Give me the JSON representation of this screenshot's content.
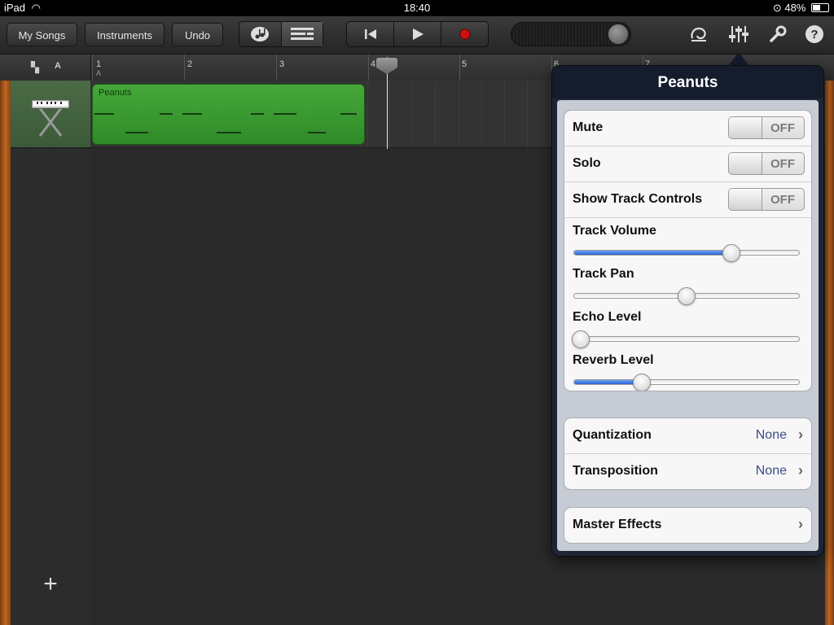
{
  "status_bar": {
    "device": "iPad",
    "time": "18:40",
    "battery": "48%"
  },
  "toolbar": {
    "my_songs": "My Songs",
    "instruments": "Instruments",
    "undo": "Undo",
    "view_toggle": {
      "left_icon": "smart-instrument-icon",
      "right_icon": "tracks-view-icon",
      "active": "tracks"
    },
    "transport": {
      "rewind_icon": "rewind-icon",
      "play_icon": "play-icon",
      "record_icon": "record-icon"
    },
    "icons": [
      "loop-icon",
      "mixer-icon",
      "settings-wrench-icon",
      "help-icon"
    ]
  },
  "ruler": {
    "marker": "A",
    "bars": [
      "1",
      "2",
      "3",
      "4",
      "5",
      "6",
      "7"
    ]
  },
  "track": {
    "instrument_icon": "keyboard-icon",
    "region_name": "Peanuts"
  },
  "popover": {
    "title": "Peanuts",
    "toggles": [
      {
        "label": "Mute",
        "state": "OFF"
      },
      {
        "label": "Solo",
        "state": "OFF"
      },
      {
        "label": "Show Track Controls",
        "state": "OFF"
      }
    ],
    "sliders": [
      {
        "label": "Track Volume",
        "value": 0.7
      },
      {
        "label": "Track Pan",
        "value": 0.5
      },
      {
        "label": "Echo Level",
        "value": 0.03
      },
      {
        "label": "Reverb Level",
        "value": 0.3
      }
    ],
    "settings": [
      {
        "label": "Quantization",
        "value": "None"
      },
      {
        "label": "Transposition",
        "value": "None"
      }
    ],
    "master_effects": "Master Effects"
  },
  "colors": {
    "region": "#3a9a30",
    "slider_fill": "#2b63d6",
    "record": "#d01010"
  }
}
